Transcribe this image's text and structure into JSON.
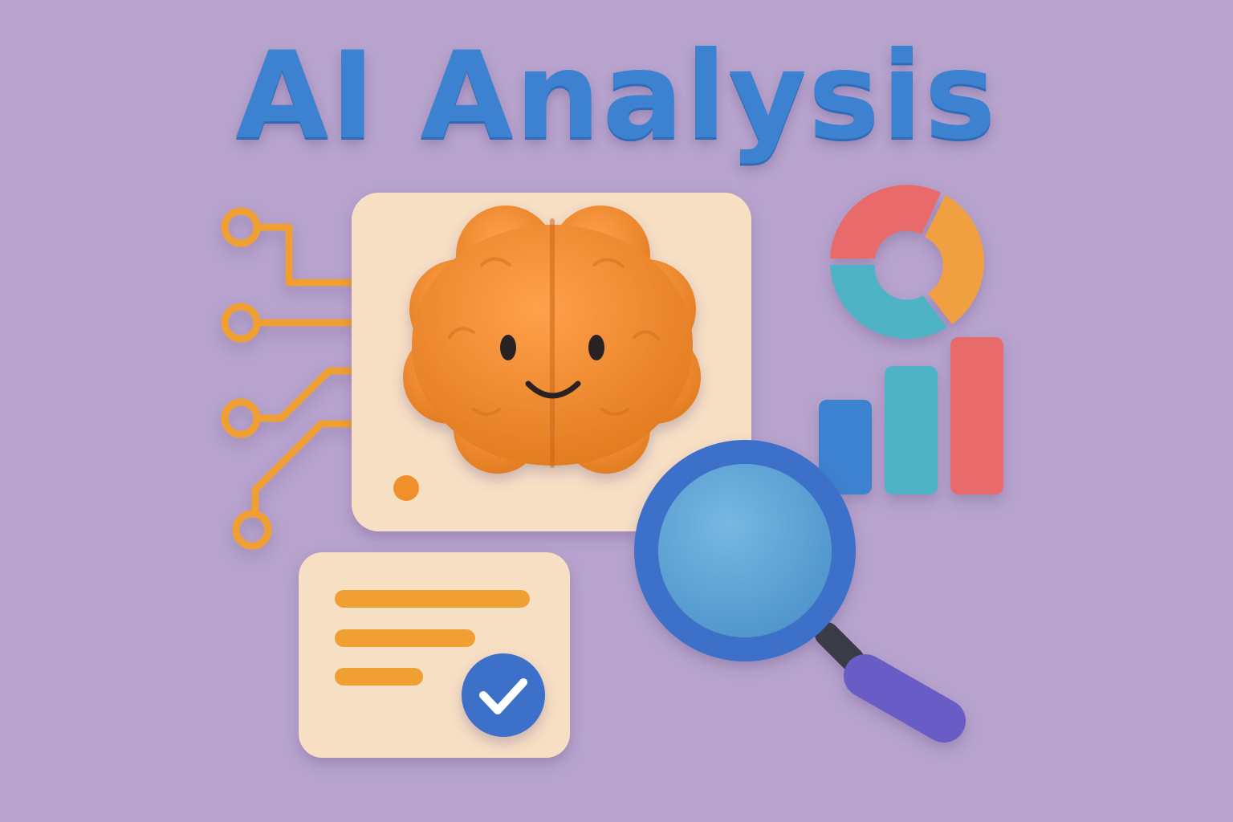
{
  "title": "AI Analysis",
  "colors": {
    "background": "#b7a3cd",
    "title": "#3d82d1",
    "brain": "#f08a2c",
    "card": "#f7dfc4",
    "circuit": "#f0a030",
    "donut": [
      "#e86a6a",
      "#f0a040",
      "#4fb3c6"
    ],
    "bars": [
      "#3d82d1",
      "#4fb3c6",
      "#e86a6a"
    ],
    "magnifier_ring": "#3d6fc9",
    "magnifier_lens": "#61a7d8",
    "magnifier_handle": "#6a5bc7",
    "checkmark_badge": "#3d6fc9"
  },
  "icons": [
    "circuit-lines-icon",
    "brain-icon",
    "donut-chart-icon",
    "bar-chart-icon",
    "magnifying-glass-icon",
    "document-card-icon",
    "checkmark-icon"
  ]
}
